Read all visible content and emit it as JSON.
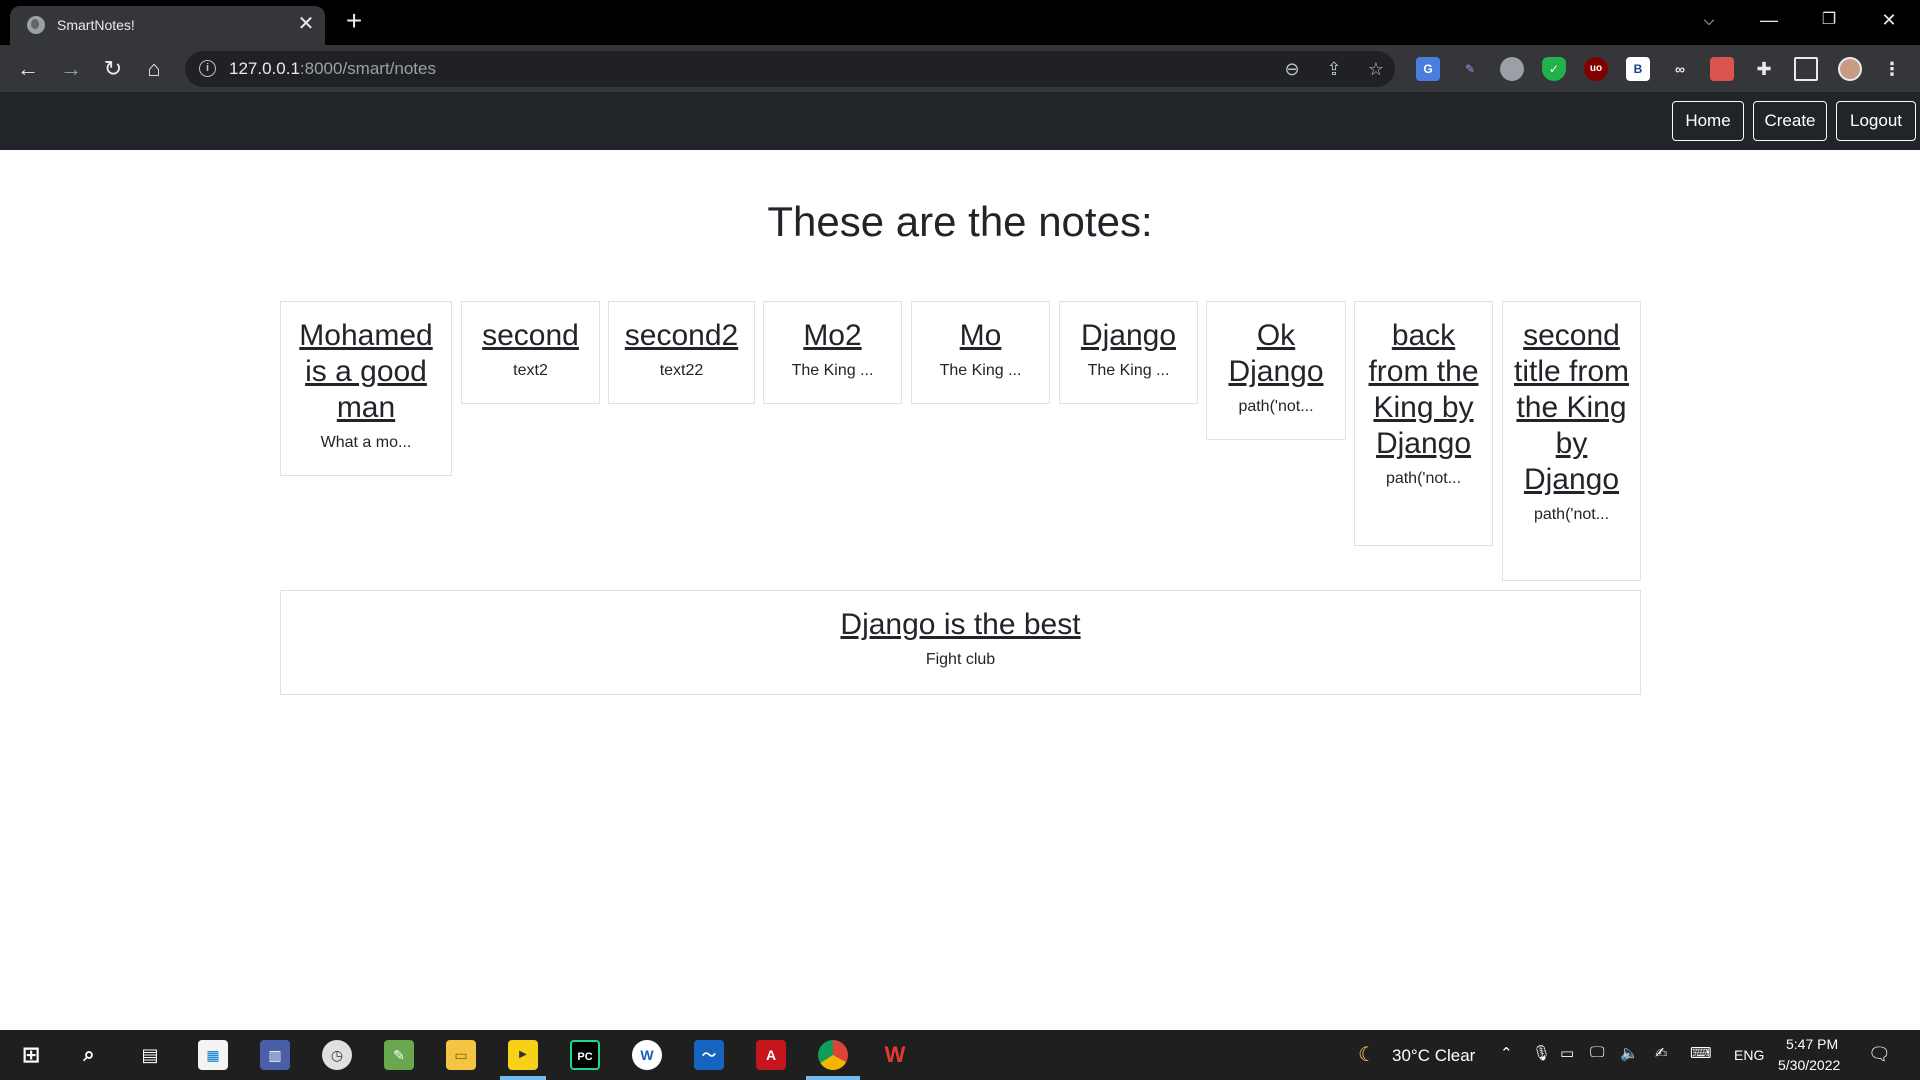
{
  "browser": {
    "tab_title": "SmartNotes!",
    "url_host": "127.0.0.1",
    "url_rest": ":8000/smart/notes"
  },
  "site_nav": {
    "links": [
      {
        "label": "Home"
      },
      {
        "label": "Create"
      },
      {
        "label": "Logout"
      }
    ]
  },
  "page": {
    "heading": "These are the notes:",
    "notes": [
      {
        "title": "Mohamed is a good man",
        "text": "What a mo..."
      },
      {
        "title": "second",
        "text": "text2"
      },
      {
        "title": "second2",
        "text": "text22"
      },
      {
        "title": "Mo2",
        "text": "The King ..."
      },
      {
        "title": "Mo",
        "text": "The King ..."
      },
      {
        "title": "Django",
        "text": "The King ..."
      },
      {
        "title": "Ok Django",
        "text": "path('not..."
      },
      {
        "title": "back from the King by Django",
        "text": "path('not..."
      },
      {
        "title": "second title from the King by Django",
        "text": "path('not..."
      },
      {
        "title": "Django is the best",
        "text": "Fight club"
      }
    ]
  },
  "taskbar": {
    "weather": "30°C  Clear",
    "language": "ENG",
    "time": "5:47 PM",
    "date": "5/30/2022",
    "apps": [
      "start-icon",
      "search-icon",
      "task-view-icon",
      "store-icon",
      "calculator-icon",
      "clock-icon",
      "notepad-icon",
      "file-explorer-icon",
      "player-icon",
      "pycharm-icon",
      "word-icon",
      "mail-icon",
      "acrobat-icon",
      "chrome-icon",
      "wps-icon"
    ]
  }
}
